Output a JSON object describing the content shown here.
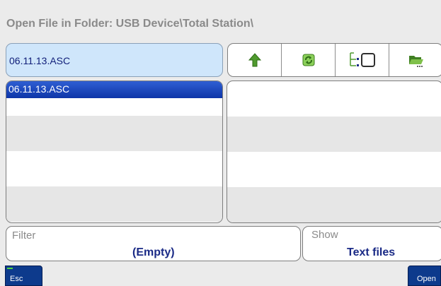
{
  "header": {
    "title": "Open File in Folder: USB Device\\Total Station\\"
  },
  "path_field": {
    "value": "06.11.13.ASC"
  },
  "toolbar": {
    "buttons": [
      {
        "icon": "up-arrow-icon",
        "color": "#4f9a2e"
      },
      {
        "icon": "refresh-icon",
        "color": "#4f9a2e"
      },
      {
        "icon": "tree-view-icon",
        "color": "#4f9a2e"
      },
      {
        "icon": "folder-open-icon",
        "color": "#5b9b2c"
      }
    ]
  },
  "file_list": {
    "items": [
      {
        "label": "06.11.13.ASC",
        "selected": true
      }
    ],
    "selection_color": "#0d35a8"
  },
  "filter": {
    "label": "Filter",
    "value": "(Empty)"
  },
  "show": {
    "label": "Show",
    "value": "Text files"
  },
  "softkeys": {
    "esc_label": "Esc",
    "open_label": "Open"
  }
}
